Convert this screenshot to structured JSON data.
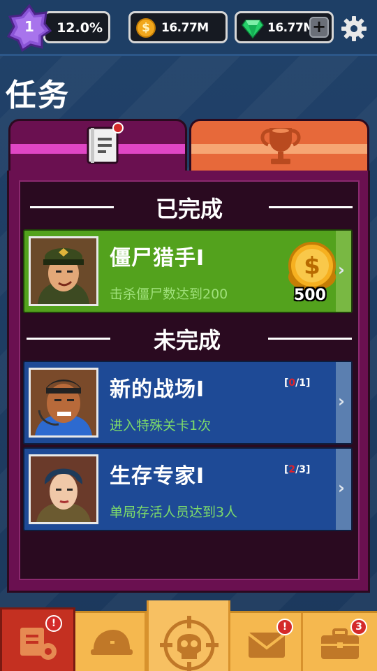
{
  "topbar": {
    "level": "1",
    "xp_percent": "12.0%",
    "coins": "16.77M",
    "gems": "16.77M",
    "plus_label": "+"
  },
  "page": {
    "title": "任务"
  },
  "tabs": [
    {
      "name": "missions",
      "active": true,
      "has_dot": true
    },
    {
      "name": "achievements",
      "active": false
    }
  ],
  "sections": {
    "completed_label": "已完成",
    "incomplete_label": "未完成"
  },
  "missions": [
    {
      "name": "僵尸猎手I",
      "description": "击杀僵尸数达到200",
      "status": "completed",
      "reward": "500"
    },
    {
      "name": "新的战场I",
      "description": "进入特殊关卡1次",
      "status": "incomplete",
      "progress_open": "[",
      "progress_current": "0",
      "progress_total": "/1]"
    },
    {
      "name": "生存专家I",
      "description": "单局存活人员达到3人",
      "status": "incomplete",
      "progress_open": "[",
      "progress_current": "2",
      "progress_total": "/3]"
    }
  ],
  "bottom_nav": {
    "missions_badge": "!",
    "mail_badge": "!",
    "shop_badge": "3"
  },
  "colors": {
    "completed_card": "#53a21d",
    "incomplete_card": "#1e4a96",
    "panel": "#6a1050",
    "nav": "#f5b84f",
    "active_nav": "#c43021"
  }
}
